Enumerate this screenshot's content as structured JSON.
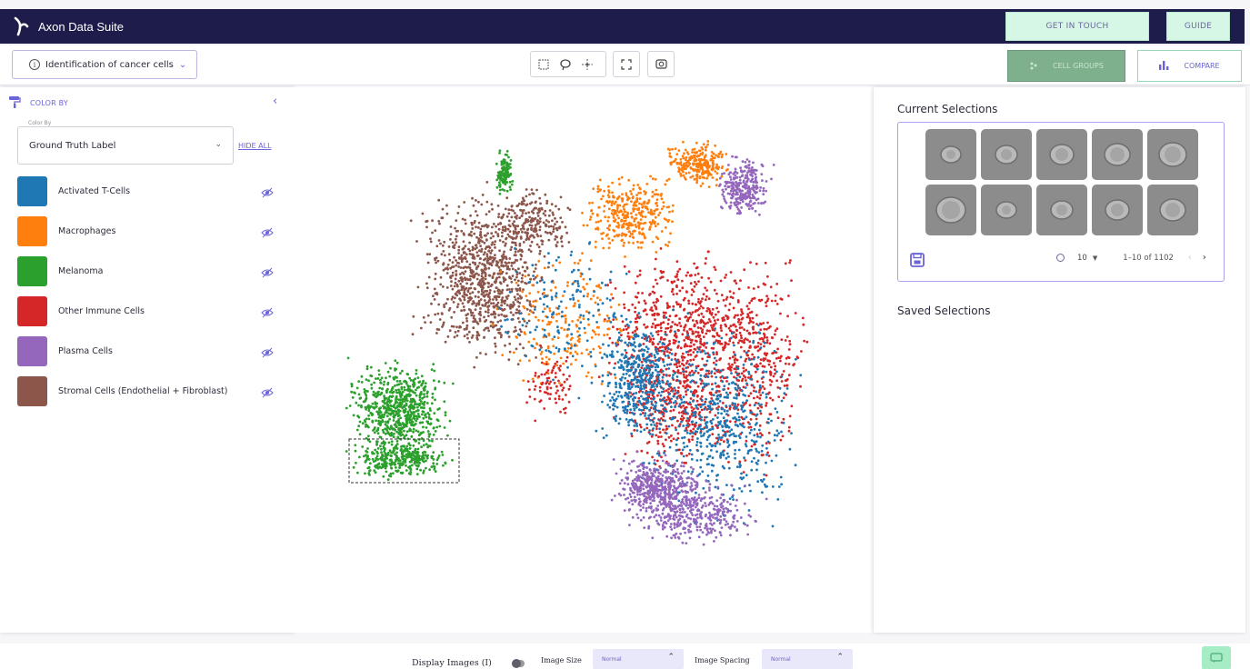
{
  "header": {
    "app_title": "Axon Data Suite",
    "get_in_touch": "GET IN TOUCH",
    "guide": "GUIDE"
  },
  "toolbar": {
    "dataset": "Identification of cancer cells",
    "tools": [
      "rectangle-select-icon",
      "lasso-select-icon",
      "pan-icon",
      "fit-view-icon",
      "screenshot-icon"
    ],
    "cell_groups": "CELL GROUPS",
    "compare": "COMPARE"
  },
  "left_panel": {
    "title": "COLOR BY",
    "select_legend": "Color By",
    "select_value": "Ground Truth Label",
    "hide_all": "HIDE ALL",
    "categories": [
      {
        "label": "Activated T-Cells",
        "color": "#1f77b4"
      },
      {
        "label": "Macrophages",
        "color": "#ff7f0e"
      },
      {
        "label": "Melanoma",
        "color": "#2ca02c"
      },
      {
        "label": "Other Immune Cells",
        "color": "#d62728"
      },
      {
        "label": "Plasma Cells",
        "color": "#9467bd"
      },
      {
        "label": "Stromal Cells (Endothelial + Fibroblast)",
        "color": "#8c564b"
      }
    ]
  },
  "right_panel": {
    "current_title": "Current Selections",
    "rows_per_page": "10",
    "range": "1–10 of 1102",
    "saved_title": "Saved Selections",
    "thumbnail_count": 10
  },
  "bottom_bar": {
    "display_images": "Display Images (I)",
    "image_size_label": "Image Size",
    "image_size_value": "Normal",
    "image_spacing_label": "Image Spacing",
    "image_spacing_value": "Normal"
  },
  "colors": {
    "accent": "#6b63d8",
    "header_bg": "#1d1c4b",
    "button_green": "#d6f6e6"
  }
}
